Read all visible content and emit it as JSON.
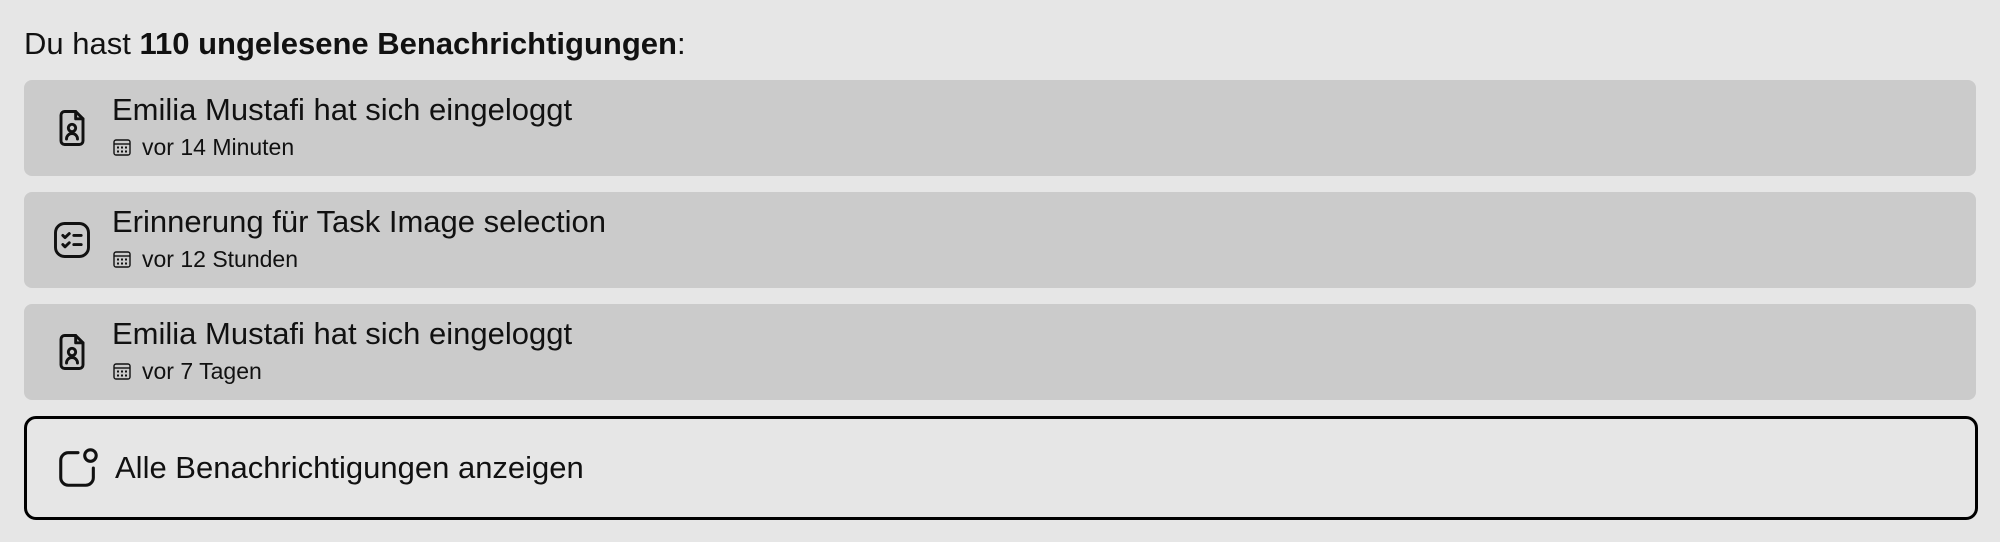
{
  "header": {
    "prefix": "Du hast ",
    "count_text": "110 ungelesene Benachrichtigungen",
    "suffix": ":"
  },
  "notifications": [
    {
      "icon": "user-file-icon",
      "title": "Emilia Mustafi hat sich eingeloggt",
      "time": "vor 14 Minuten"
    },
    {
      "icon": "checklist-icon",
      "title": "Erinnerung für Task Image selection",
      "time": "vor 12 Stunden"
    },
    {
      "icon": "user-file-icon",
      "title": "Emilia Mustafi hat sich eingeloggt",
      "time": "vor 7 Tagen"
    }
  ],
  "footer": {
    "icon": "notification-icon",
    "label": "Alle Benachrichtigungen anzeigen"
  },
  "icons": {
    "meta": "calendar-icon"
  },
  "colors": {
    "background": "#e6e6e6",
    "item_background": "#cbcbcb",
    "text": "#111111",
    "border": "#000000"
  }
}
